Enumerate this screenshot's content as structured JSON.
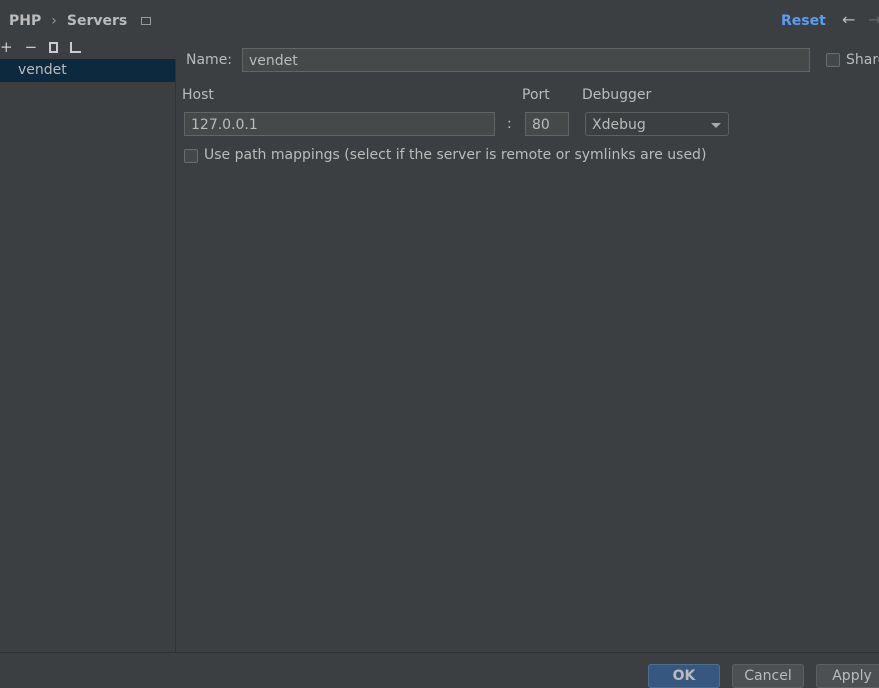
{
  "breadcrumb": {
    "parent": "PHP",
    "separator": "›",
    "current": "Servers"
  },
  "header": {
    "reset": "Reset",
    "back": "←",
    "forward": "→"
  },
  "toolbar": {
    "add": "+",
    "remove": "−"
  },
  "servers": [
    {
      "name": "vendet",
      "selected": true
    }
  ],
  "form": {
    "name_label": "Name:",
    "name_value": "vendet",
    "share_label": "Share",
    "host_label": "Host",
    "host_value": "127.0.0.1",
    "colon": ":",
    "port_label": "Port",
    "port_value": "80",
    "debugger_label": "Debugger",
    "debugger_value": "Xdebug",
    "path_mappings_label": "Use path mappings (select if the server is remote or symlinks are used)",
    "path_mappings_checked": false
  },
  "buttons": {
    "ok": "OK",
    "cancel": "Cancel",
    "apply": "Apply"
  },
  "colors": {
    "accent": "#589df6",
    "selection": "#0d293e",
    "ok_button": "#365880"
  }
}
